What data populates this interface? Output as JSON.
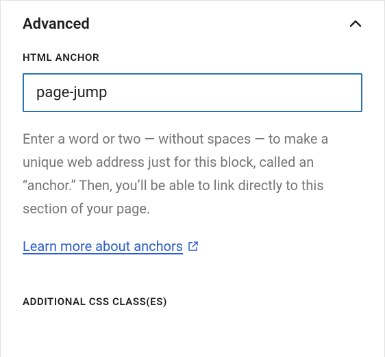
{
  "panel": {
    "title": "Advanced",
    "anchor": {
      "label": "HTML ANCHOR",
      "value": "page-jump",
      "help": "Enter a word or two — without spaces — to make a unique web address just for this block, called an “anchor.” Then, you’ll be able to link directly to this section of your page.",
      "link_text": "Learn more about anchors"
    },
    "additional_css": {
      "label": "ADDITIONAL CSS CLASS(ES)"
    }
  }
}
